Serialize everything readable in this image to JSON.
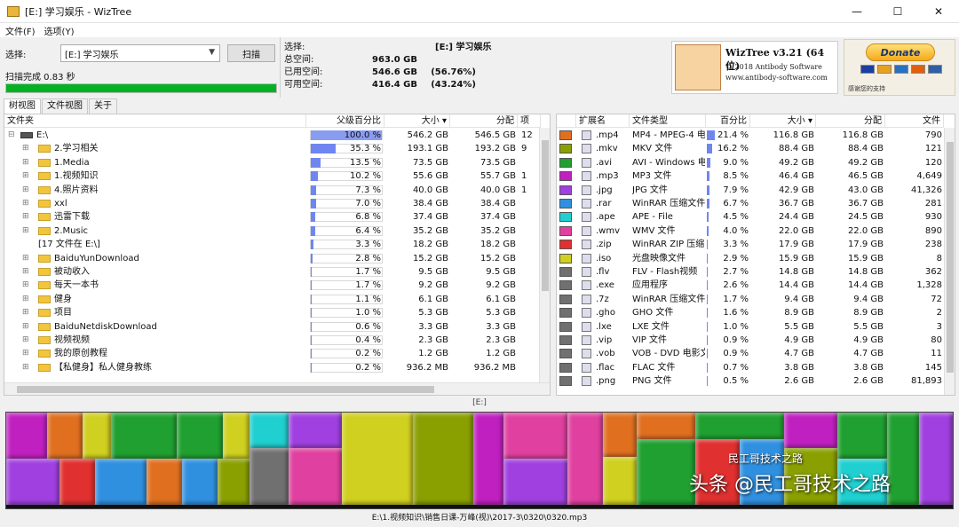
{
  "window": {
    "title": "[E:] 学习娱乐 - WizTree",
    "minimize": "—",
    "maximize": "☐",
    "close": "✕"
  },
  "menu": [
    "文件(F)",
    "选项(Y)"
  ],
  "select": {
    "label": "选择:",
    "drive": "[E:] 学习娱乐",
    "scan_button": "扫描",
    "status": "扫描完成 0.83 秒",
    "progress": 1.0
  },
  "drive_info": {
    "select_label": "选择:",
    "select_value": "[E:] 学习娱乐",
    "rows": [
      {
        "k": "总空间:",
        "v": "963.0 GB",
        "p": ""
      },
      {
        "k": "已用空间:",
        "v": "546.6 GB",
        "p": "(56.76%)"
      },
      {
        "k": "可用空间:",
        "v": "416.4 GB",
        "p": "(43.24%)"
      }
    ]
  },
  "logo": {
    "title": "WizTree v3.21 (64 位)",
    "copyright": "© 2018 Antibody Software",
    "url": "www.antibody-software.com"
  },
  "donate": {
    "button": "Donate",
    "note": "感谢您的支持"
  },
  "tabs": [
    "树视图",
    "文件视图",
    "关于"
  ],
  "tree": {
    "headers": [
      "文件夹",
      "父级百分比",
      "大小 ▾",
      "分配",
      "项"
    ],
    "rows": [
      {
        "name": "E:\\",
        "pct": "100.0 %",
        "frac": 1.0,
        "size": "546.2 GB",
        "alloc": "546.5 GB",
        "items": "12",
        "expander": "⊟",
        "root": true
      },
      {
        "name": "2.学习相关",
        "pct": "35.3 %",
        "frac": 0.353,
        "size": "193.1 GB",
        "alloc": "193.2 GB",
        "items": "9",
        "expander": "⊞"
      },
      {
        "name": "1.Media",
        "pct": "13.5 %",
        "frac": 0.135,
        "size": "73.5 GB",
        "alloc": "73.5 GB",
        "items": "",
        "expander": "⊞"
      },
      {
        "name": "1.视频知识",
        "pct": "10.2 %",
        "frac": 0.102,
        "size": "55.6 GB",
        "alloc": "55.7 GB",
        "items": "1",
        "expander": "⊞"
      },
      {
        "name": "4.照片资料",
        "pct": "7.3 %",
        "frac": 0.073,
        "size": "40.0 GB",
        "alloc": "40.0 GB",
        "items": "1",
        "expander": "⊞"
      },
      {
        "name": "xxl",
        "pct": "7.0 %",
        "frac": 0.07,
        "size": "38.4 GB",
        "alloc": "38.4 GB",
        "items": "",
        "expander": "⊞"
      },
      {
        "name": "迅雷下载",
        "pct": "6.8 %",
        "frac": 0.068,
        "size": "37.4 GB",
        "alloc": "37.4 GB",
        "items": "",
        "expander": "⊞"
      },
      {
        "name": "2.Music",
        "pct": "6.4 %",
        "frac": 0.064,
        "size": "35.2 GB",
        "alloc": "35.2 GB",
        "items": "",
        "expander": "⊞"
      },
      {
        "name": "[17 文件在 E:\\]",
        "pct": "3.3 %",
        "frac": 0.033,
        "size": "18.2 GB",
        "alloc": "18.2 GB",
        "items": "",
        "expander": ""
      },
      {
        "name": "BaiduYunDownload",
        "pct": "2.8 %",
        "frac": 0.028,
        "size": "15.2 GB",
        "alloc": "15.2 GB",
        "items": "",
        "expander": "⊞"
      },
      {
        "name": "被动收入",
        "pct": "1.7 %",
        "frac": 0.017,
        "size": "9.5 GB",
        "alloc": "9.5 GB",
        "items": "",
        "expander": "⊞"
      },
      {
        "name": "每天一本书",
        "pct": "1.7 %",
        "frac": 0.017,
        "size": "9.2 GB",
        "alloc": "9.2 GB",
        "items": "",
        "expander": "⊞"
      },
      {
        "name": "健身",
        "pct": "1.1 %",
        "frac": 0.011,
        "size": "6.1 GB",
        "alloc": "6.1 GB",
        "items": "",
        "expander": "⊞"
      },
      {
        "name": "项目",
        "pct": "1.0 %",
        "frac": 0.01,
        "size": "5.3 GB",
        "alloc": "5.3 GB",
        "items": "",
        "expander": "⊞"
      },
      {
        "name": "BaiduNetdiskDownload",
        "pct": "0.6 %",
        "frac": 0.006,
        "size": "3.3 GB",
        "alloc": "3.3 GB",
        "items": "",
        "expander": "⊞"
      },
      {
        "name": "视频视频",
        "pct": "0.4 %",
        "frac": 0.004,
        "size": "2.3 GB",
        "alloc": "2.3 GB",
        "items": "",
        "expander": "⊞"
      },
      {
        "name": "我的原创教程",
        "pct": "0.2 %",
        "frac": 0.002,
        "size": "1.2 GB",
        "alloc": "1.2 GB",
        "items": "",
        "expander": "⊞"
      },
      {
        "name": "【私健身】私人健身教练",
        "pct": "0.2 %",
        "frac": 0.002,
        "size": "936.2 MB",
        "alloc": "936.2 MB",
        "items": "",
        "expander": "⊞"
      }
    ]
  },
  "extensions": {
    "headers": [
      "",
      "扩展名",
      "文件类型",
      "百分比",
      "大小 ▾",
      "分配",
      "文件"
    ],
    "rows": [
      {
        "color": "#e07020",
        "ext": ".mp4",
        "type": "MP4 - MPEG-4 电影",
        "pct": "21.4 %",
        "frac": 0.214,
        "size": "116.8 GB",
        "alloc": "116.8 GB",
        "files": "790"
      },
      {
        "color": "#8aa000",
        "ext": ".mkv",
        "type": "MKV 文件",
        "pct": "16.2 %",
        "frac": 0.162,
        "size": "88.4 GB",
        "alloc": "88.4 GB",
        "files": "121"
      },
      {
        "color": "#20a030",
        "ext": ".avi",
        "type": "AVI - Windows 电影",
        "pct": "9.0 %",
        "frac": 0.09,
        "size": "49.2 GB",
        "alloc": "49.2 GB",
        "files": "120"
      },
      {
        "color": "#c020c0",
        "ext": ".mp3",
        "type": "MP3 文件",
        "pct": "8.5 %",
        "frac": 0.085,
        "size": "46.4 GB",
        "alloc": "46.5 GB",
        "files": "4,649"
      },
      {
        "color": "#a040e0",
        "ext": ".jpg",
        "type": "JPG 文件",
        "pct": "7.9 %",
        "frac": 0.079,
        "size": "42.9 GB",
        "alloc": "43.0 GB",
        "files": "41,326"
      },
      {
        "color": "#3090e0",
        "ext": ".rar",
        "type": "WinRAR 压缩文件",
        "pct": "6.7 %",
        "frac": 0.067,
        "size": "36.7 GB",
        "alloc": "36.7 GB",
        "files": "281"
      },
      {
        "color": "#20d0d0",
        "ext": ".ape",
        "type": "APE - File",
        "pct": "4.5 %",
        "frac": 0.045,
        "size": "24.4 GB",
        "alloc": "24.5 GB",
        "files": "930"
      },
      {
        "color": "#e040a0",
        "ext": ".wmv",
        "type": "WMV 文件",
        "pct": "4.0 %",
        "frac": 0.04,
        "size": "22.0 GB",
        "alloc": "22.0 GB",
        "files": "890"
      },
      {
        "color": "#e03030",
        "ext": ".zip",
        "type": "WinRAR ZIP 压缩",
        "pct": "3.3 %",
        "frac": 0.033,
        "size": "17.9 GB",
        "alloc": "17.9 GB",
        "files": "238"
      },
      {
        "color": "#d0d020",
        "ext": ".iso",
        "type": "光盘映像文件",
        "pct": "2.9 %",
        "frac": 0.029,
        "size": "15.9 GB",
        "alloc": "15.9 GB",
        "files": "8"
      },
      {
        "color": "#707070",
        "ext": ".flv",
        "type": "FLV - Flash视频",
        "pct": "2.7 %",
        "frac": 0.027,
        "size": "14.8 GB",
        "alloc": "14.8 GB",
        "files": "362"
      },
      {
        "color": "#707070",
        "ext": ".exe",
        "type": "应用程序",
        "pct": "2.6 %",
        "frac": 0.026,
        "size": "14.4 GB",
        "alloc": "14.4 GB",
        "files": "1,328"
      },
      {
        "color": "#707070",
        "ext": ".7z",
        "type": "WinRAR 压缩文件",
        "pct": "1.7 %",
        "frac": 0.017,
        "size": "9.4 GB",
        "alloc": "9.4 GB",
        "files": "72"
      },
      {
        "color": "#707070",
        "ext": ".gho",
        "type": "GHO 文件",
        "pct": "1.6 %",
        "frac": 0.016,
        "size": "8.9 GB",
        "alloc": "8.9 GB",
        "files": "2"
      },
      {
        "color": "#707070",
        "ext": ".lxe",
        "type": "LXE 文件",
        "pct": "1.0 %",
        "frac": 0.01,
        "size": "5.5 GB",
        "alloc": "5.5 GB",
        "files": "3"
      },
      {
        "color": "#707070",
        "ext": ".vip",
        "type": "VIP 文件",
        "pct": "0.9 %",
        "frac": 0.009,
        "size": "4.9 GB",
        "alloc": "4.9 GB",
        "files": "80"
      },
      {
        "color": "#707070",
        "ext": ".vob",
        "type": "VOB - DVD 电影文",
        "pct": "0.9 %",
        "frac": 0.009,
        "size": "4.7 GB",
        "alloc": "4.7 GB",
        "files": "11"
      },
      {
        "color": "#707070",
        "ext": ".flac",
        "type": "FLAC 文件",
        "pct": "0.7 %",
        "frac": 0.007,
        "size": "3.8 GB",
        "alloc": "3.8 GB",
        "files": "145"
      },
      {
        "color": "#707070",
        "ext": ".png",
        "type": "PNG 文件",
        "pct": "0.5 %",
        "frac": 0.005,
        "size": "2.6 GB",
        "alloc": "2.6 GB",
        "files": "81,893"
      }
    ]
  },
  "treemap": {
    "label": "[E:]",
    "colors": [
      "#e07020",
      "#20a030",
      "#8aa000",
      "#c020c0",
      "#a040e0",
      "#3090e0",
      "#20d0d0",
      "#e040a0",
      "#e03030",
      "#d0d020",
      "#707070"
    ]
  },
  "status_path": "E:\\1.视频知识\\销售日课-万峰(视)\\2017-3\\0320\\0320.mp3",
  "watermark": {
    "large": "头条 @民工哥技术之路",
    "small": "民工哥技术之路"
  }
}
